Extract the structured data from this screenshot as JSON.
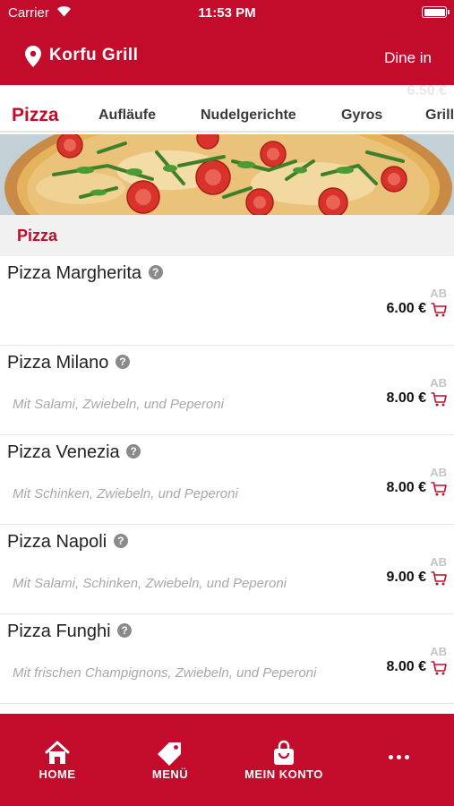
{
  "status_bar": {
    "carrier": "Carrier",
    "time": "11:53 PM"
  },
  "header": {
    "restaurant": "Korfu Grill",
    "mode": "Dine in"
  },
  "tabs": [
    {
      "label": "Pizza",
      "active": true
    },
    {
      "label": "Aufläufe",
      "active": false
    },
    {
      "label": "Nudelgerichte",
      "active": false
    },
    {
      "label": "Gyros",
      "active": false
    },
    {
      "label": "Grill",
      "active": false
    }
  ],
  "ghost_price": "6.50 €",
  "section": {
    "title": "Pizza"
  },
  "items": [
    {
      "name": "Pizza Margherita",
      "description": "",
      "ab": "AB",
      "price": "6.00 €"
    },
    {
      "name": "Pizza Milano",
      "description": "Mit Salami, Zwiebeln, und Peperoni",
      "ab": "AB",
      "price": "8.00 €"
    },
    {
      "name": "Pizza Venezia",
      "description": "Mit Schinken, Zwiebeln, und Peperoni",
      "ab": "AB",
      "price": "8.00 €"
    },
    {
      "name": "Pizza Napoli",
      "description": "Mit Salami, Schinken, Zwiebeln, und Peperoni",
      "ab": "AB",
      "price": "9.00 €"
    },
    {
      "name": "Pizza Funghi",
      "description": "Mit frischen Champignons, Zwiebeln, und Peperoni",
      "ab": "AB",
      "price": "8.00 €"
    }
  ],
  "bottom_nav": [
    {
      "label": "HOME",
      "icon": "home-icon"
    },
    {
      "label": "MENÜ",
      "icon": "tag-icon"
    },
    {
      "label": "MEIN KONTO",
      "icon": "shopping-bag-icon"
    },
    {
      "label": "",
      "icon": "more-icon"
    }
  ],
  "colors": {
    "brand": "#c30b2c",
    "section_bg": "#f1f1f1",
    "description": "#a8a8a8"
  }
}
